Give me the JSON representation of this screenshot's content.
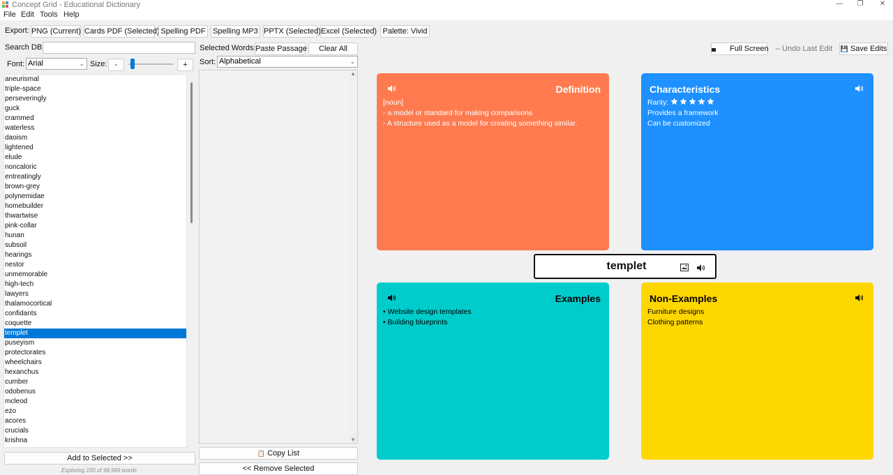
{
  "window": {
    "title": "Concept Grid - Educational Dictionary"
  },
  "menu": {
    "items": [
      "File",
      "Edit",
      "Tools",
      "Help"
    ]
  },
  "export": {
    "label": "Export:",
    "buttons": [
      "PNG (Current)",
      "Cards PDF (Selected)",
      "Spelling PDF",
      "Spelling MP3",
      "PPTX (Selected)",
      "Excel (Selected)",
      "Palette: Vivid"
    ]
  },
  "search": {
    "label": "Search DB:",
    "value": ""
  },
  "font": {
    "label": "Font:",
    "value": "Arial",
    "size_label": "Size:",
    "minus": "-",
    "plus": "+"
  },
  "selected": {
    "label": "Selected Words:",
    "paste": "Paste Passage",
    "clear": "Clear All",
    "sort_label": "Sort:",
    "sort_value": "Alphabetical",
    "copy": "Copy List",
    "remove": "<< Remove Selected"
  },
  "wordlist": {
    "items": [
      "aneurismal",
      "triple-space",
      "perseveringly",
      "guck",
      "crammed",
      "waterless",
      "daoism",
      "lightened",
      "elude",
      "noncaloric",
      "entreatingly",
      "brown-grey",
      "polynemidae",
      "homebuilder",
      "thwartwise",
      "pink-collar",
      "hunan",
      "subsoil",
      "hearings",
      "nestor",
      "unmemorable",
      "high-tech",
      "lawyers",
      "thalamocortical",
      "confidants",
      "coquette",
      "templet",
      "puseyism",
      "protectorates",
      "wheelchairs",
      "hexanchus",
      "cumber",
      "odobenus",
      "mcleod",
      "ezo",
      "acores",
      "crucials",
      "krishna"
    ],
    "selected_index": 26,
    "add_button": "Add to Selected >>",
    "footer": "Exploring 100 of 98,569 words"
  },
  "right_toolbar": {
    "fullscreen": "Full Screen",
    "undo": "Undo Last Edit",
    "save": "Save Edits"
  },
  "grid": {
    "word": "templet",
    "definition": {
      "title": "Definition",
      "color": "#ff7b4f",
      "lines": [
        "[noun]",
        "- a model or standard for making comparisons",
        "- A structure used as a model for creating something similar."
      ]
    },
    "characteristics": {
      "title": "Characteristics",
      "color": "#1e90ff",
      "rarity_label": "Rarity:",
      "rarity_stars": 5,
      "lines": [
        "Provides a framework",
        "Can be customized"
      ]
    },
    "examples": {
      "title": "Examples",
      "color": "#00cccc",
      "lines": [
        "• Website design templates",
        "• Building blueprints"
      ]
    },
    "non_examples": {
      "title": "Non-Examples",
      "color": "#ffd700",
      "lines": [
        "Furniture designs",
        "Clothing patterns"
      ]
    }
  }
}
